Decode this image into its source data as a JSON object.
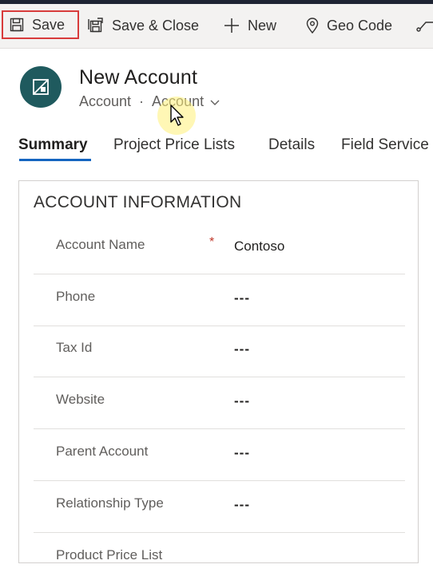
{
  "toolbar": {
    "save_label": "Save",
    "save_close_label": "Save & Close",
    "new_label": "New",
    "geo_code_label": "Geo Code"
  },
  "header": {
    "title": "New Account",
    "entity_label": "Account",
    "separator": "·",
    "form_selector": "Account"
  },
  "tabs": [
    {
      "label": "Summary",
      "active": true
    },
    {
      "label": "Project Price Lists",
      "active": false
    },
    {
      "label": "Details",
      "active": false
    },
    {
      "label": "Field Service",
      "active": false
    }
  ],
  "section": {
    "title": "ACCOUNT INFORMATION",
    "fields": [
      {
        "label": "Account Name",
        "required": "*",
        "value": "Contoso"
      },
      {
        "label": "Phone",
        "required": "",
        "value": "---"
      },
      {
        "label": "Tax Id",
        "required": "",
        "value": "---"
      },
      {
        "label": "Website",
        "required": "",
        "value": "---"
      },
      {
        "label": "Parent Account",
        "required": "",
        "value": "---"
      },
      {
        "label": "Relationship Type",
        "required": "",
        "value": "---"
      },
      {
        "label": "Product Price List",
        "required": "",
        "value": ""
      }
    ]
  },
  "colors": {
    "accent": "#1565c0",
    "entity_icon_bg": "#1f5a5e",
    "highlight_border": "#d83b3b",
    "required_marker": "#c0392b"
  }
}
